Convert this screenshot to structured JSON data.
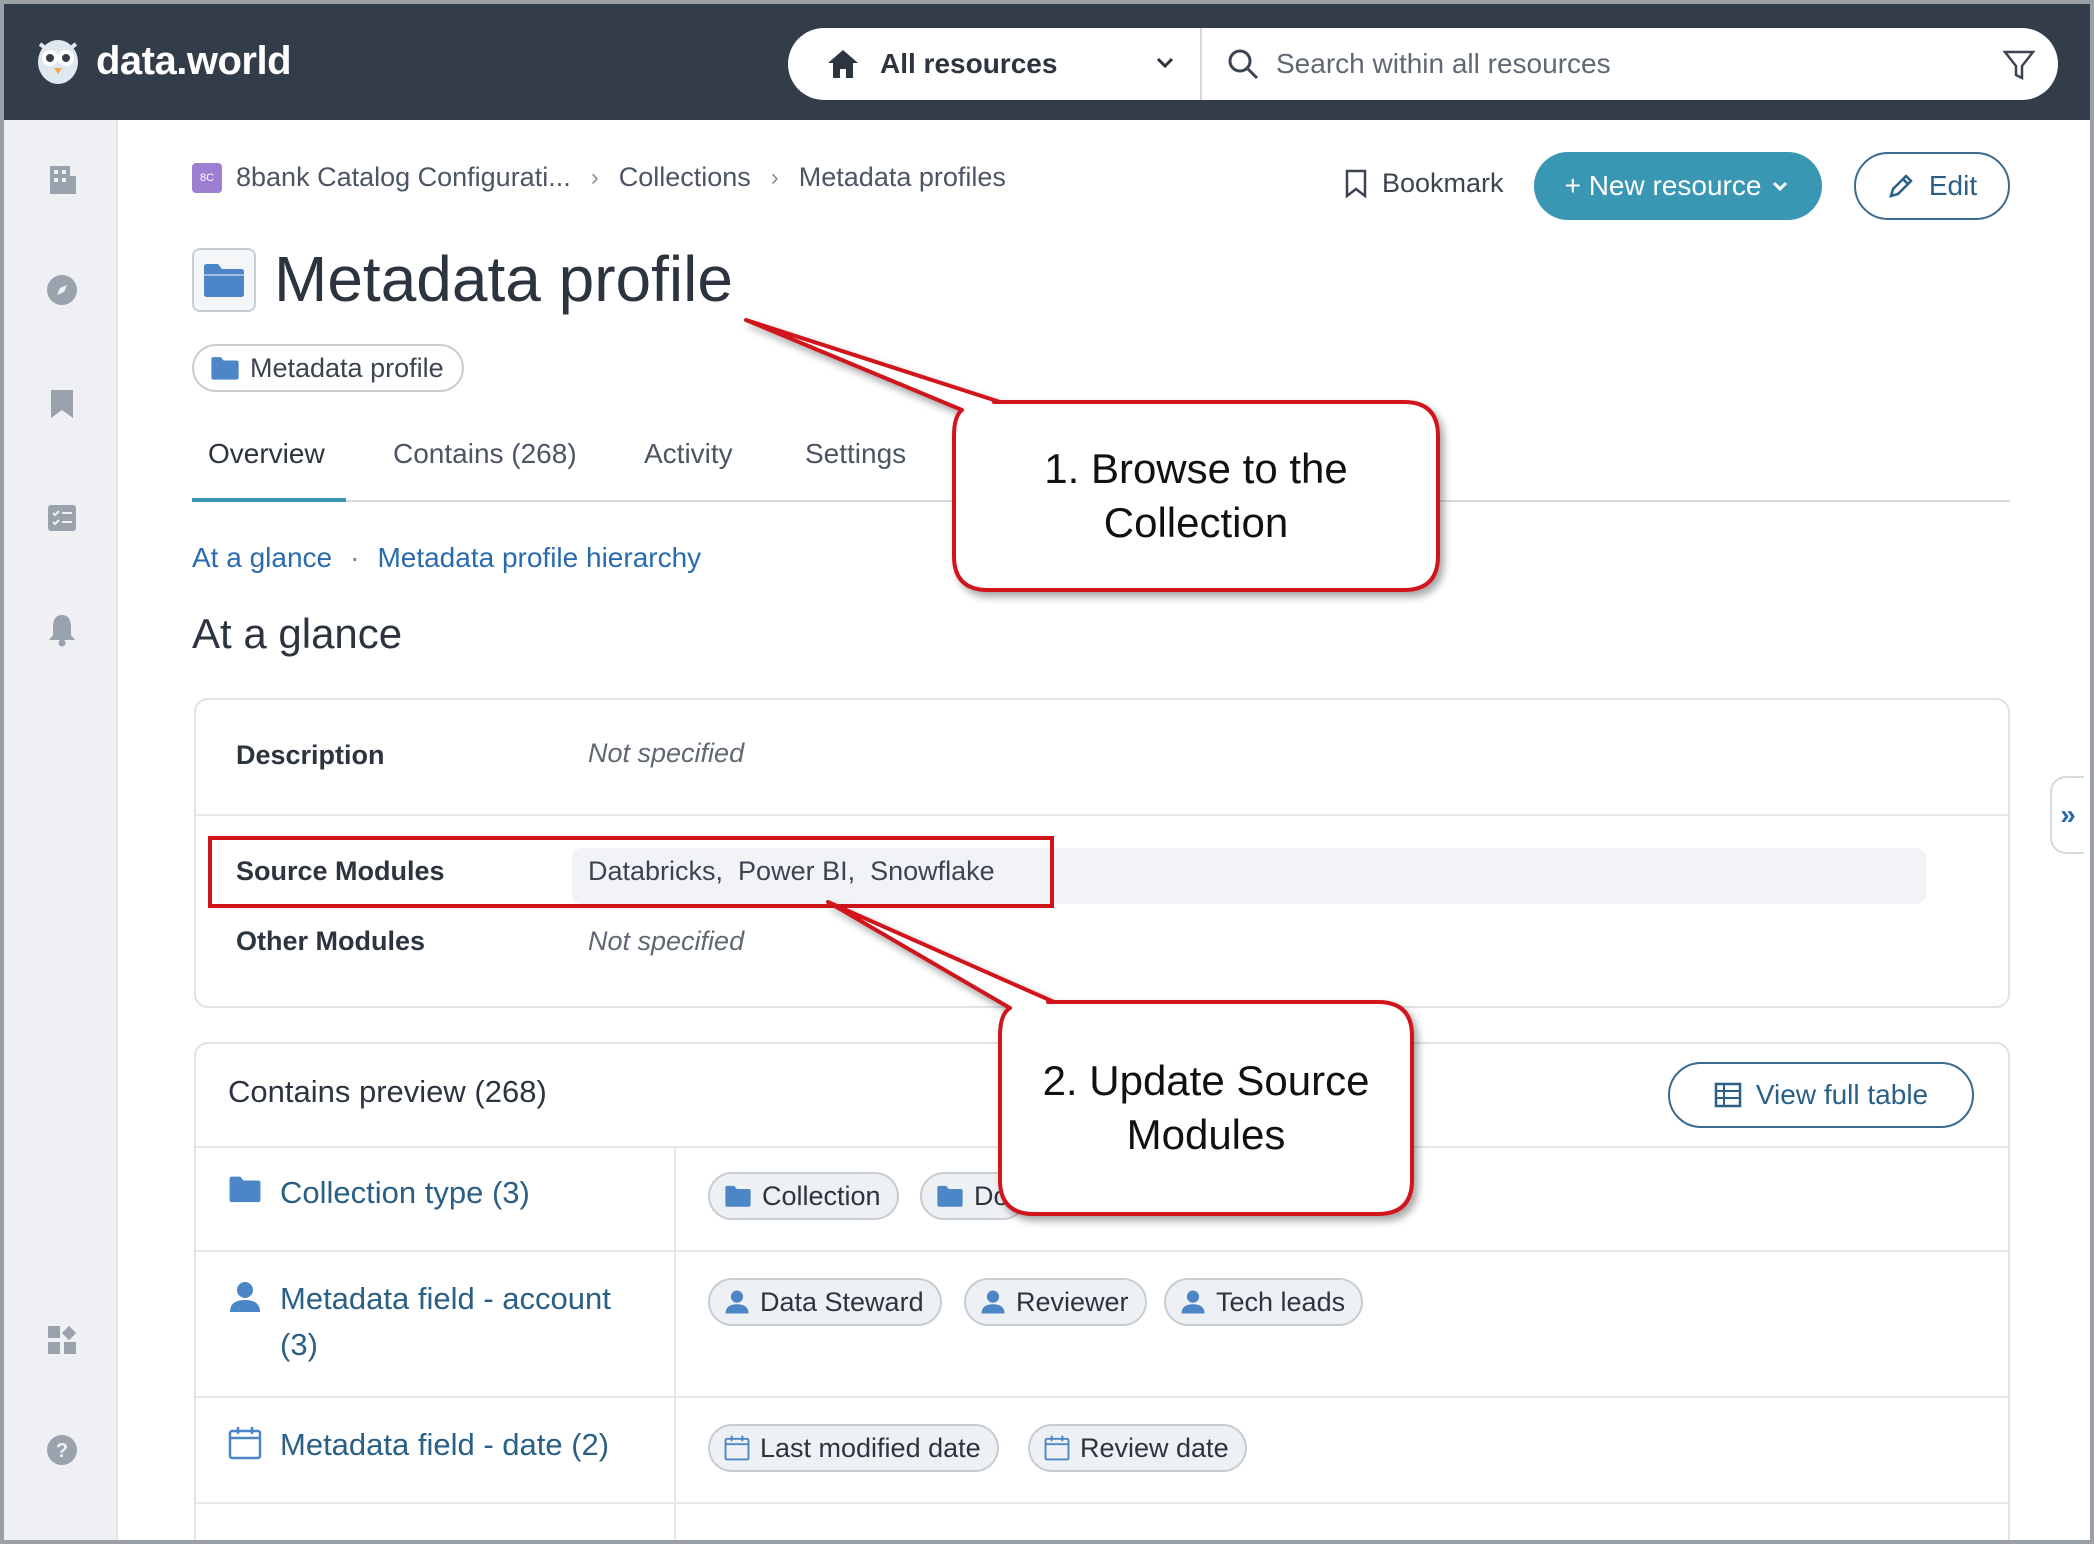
{
  "app": {
    "logo_text": "data.world"
  },
  "search": {
    "scope_label": "All resources",
    "placeholder": "Search within all resources"
  },
  "breadcrumb": {
    "badge": "8C",
    "items": [
      "8bank Catalog Configurati...",
      "Collections",
      "Metadata profiles"
    ]
  },
  "actions": {
    "bookmark_label": "Bookmark",
    "new_resource_label": "+ New resource",
    "edit_label": "Edit"
  },
  "page": {
    "title": "Metadata profile",
    "type_chip": "Metadata profile"
  },
  "tabs": [
    {
      "label": "Overview",
      "active": true
    },
    {
      "label": "Contains (268)",
      "active": false
    },
    {
      "label": "Activity",
      "active": false
    },
    {
      "label": "Settings",
      "active": false
    }
  ],
  "subnav": {
    "items": [
      "At a glance",
      "Metadata profile hierarchy"
    ]
  },
  "glance": {
    "section_title": "At a glance",
    "rows": [
      {
        "key": "Description",
        "value": "Not specified"
      },
      {
        "key": "Source Modules",
        "value": "Databricks,  Power BI,  Snowflake"
      },
      {
        "key": "Other Modules",
        "value": "Not specified"
      }
    ]
  },
  "contains": {
    "title": "Contains preview (268)",
    "view_label": "View full table",
    "groups": [
      {
        "label": "Collection type (3)",
        "icon": "folder-icon",
        "chips": [
          "Collection",
          "Do"
        ]
      },
      {
        "label_line1": "Metadata field - account",
        "label_line2": "(3)",
        "icon": "person-icon",
        "chips": [
          "Data Steward",
          "Reviewer",
          "Tech leads"
        ]
      },
      {
        "label": "Metadata field - date (2)",
        "icon": "calendar-icon",
        "chips": [
          "Last modified date",
          "Review date"
        ]
      }
    ]
  },
  "callouts": {
    "one_line1": "1. Browse to the",
    "one_line2": "Collection",
    "two_line1": "2. Update Source",
    "two_line2": "Modules"
  },
  "colors": {
    "topbar": "#333d4a",
    "accent": "#3a97b3",
    "link": "#2a6bb0",
    "callout_border": "#d0141c"
  }
}
